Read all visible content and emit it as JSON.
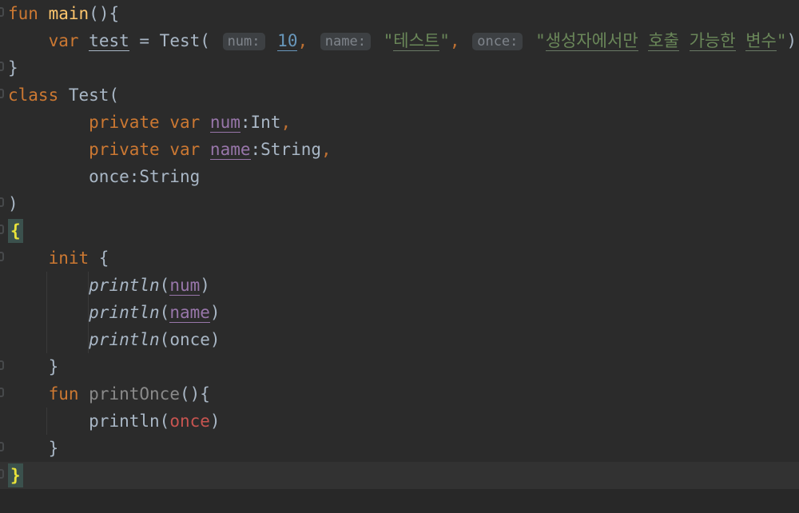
{
  "editor": {
    "language": "Kotlin",
    "theme": "Darcula",
    "colors": {
      "background": "#2B2B2B",
      "current_line": "#323232",
      "default_text": "#A9B7C6",
      "keyword": "#CC7832",
      "function_declaration": "#FFC66D",
      "number": "#6897BB",
      "string": "#6A8759",
      "property": "#9876AA",
      "unused_symbol": "#8A8A8A",
      "error": "#C75450",
      "matched_brace": "#E8E33A",
      "matched_brace_bg": "#3B514D",
      "hint_bg": "#3D4043",
      "hint_fg": "#7F848B",
      "comma": "#BE7032"
    },
    "inlay_hints": [
      "num:",
      "name:",
      "once:"
    ],
    "plain_code": "fun main(){\n    var test = Test(10, \"테스트\", \"생성자에서만 호출 가능한 변수\")\n}\nclass Test(\n        private var num:Int,\n        private var name:String,\n        once:String\n)\n{\n    init {\n        println(num)\n        println(name)\n        println(once)\n    }\n    fun printOnce(){\n        println(once)\n    }\n}",
    "lines": [
      {
        "n": 1,
        "fold": true,
        "tokens": [
          [
            "kw",
            "fun"
          ],
          [
            "sp",
            " "
          ],
          [
            "fn",
            "main"
          ],
          [
            "plain",
            "(){"
          ]
        ]
      },
      {
        "n": 2,
        "tokens": [
          [
            "sp",
            "    "
          ],
          [
            "kw",
            "var"
          ],
          [
            "sp",
            " "
          ],
          [
            "varu",
            "test"
          ],
          [
            "plain",
            " = Test("
          ],
          [
            "sp",
            " "
          ],
          [
            "hint",
            "num:"
          ],
          [
            "sp",
            " "
          ],
          [
            "num",
            "10"
          ],
          [
            "comma",
            ","
          ],
          [
            "sp",
            " "
          ],
          [
            "hint",
            "name:"
          ],
          [
            "sp",
            " "
          ],
          [
            "str",
            "\""
          ],
          [
            "typo",
            "테스트"
          ],
          [
            "str",
            "\""
          ],
          [
            "comma",
            ","
          ],
          [
            "sp",
            " "
          ],
          [
            "hint",
            "once:"
          ],
          [
            "sp",
            " "
          ],
          [
            "str",
            "\""
          ],
          [
            "typo",
            "생성자에서만"
          ],
          [
            "str",
            " "
          ],
          [
            "typo",
            "호출"
          ],
          [
            "str",
            " "
          ],
          [
            "typo",
            "가능한"
          ],
          [
            "str",
            " "
          ],
          [
            "typo",
            "변수"
          ],
          [
            "str",
            "\""
          ],
          [
            "plain",
            ")"
          ]
        ]
      },
      {
        "n": 3,
        "fold": true,
        "tokens": [
          [
            "plain",
            "}"
          ]
        ]
      },
      {
        "n": 4,
        "fold": true,
        "tokens": [
          [
            "kw",
            "class"
          ],
          [
            "plain",
            " Test("
          ]
        ]
      },
      {
        "n": 5,
        "tokens": [
          [
            "sp",
            "        "
          ],
          [
            "kw",
            "private"
          ],
          [
            "sp",
            " "
          ],
          [
            "kw",
            "var"
          ],
          [
            "sp",
            " "
          ],
          [
            "prop",
            "num"
          ],
          [
            "plain",
            ":Int"
          ],
          [
            "comma",
            ","
          ]
        ]
      },
      {
        "n": 6,
        "tokens": [
          [
            "sp",
            "        "
          ],
          [
            "kw",
            "private"
          ],
          [
            "sp",
            " "
          ],
          [
            "kw",
            "var"
          ],
          [
            "sp",
            " "
          ],
          [
            "prop",
            "name"
          ],
          [
            "plain",
            ":String"
          ],
          [
            "comma",
            ","
          ]
        ]
      },
      {
        "n": 7,
        "tokens": [
          [
            "sp",
            "        "
          ],
          [
            "plain",
            "once:String"
          ]
        ]
      },
      {
        "n": 8,
        "fold": true,
        "tokens": [
          [
            "plain",
            ")"
          ]
        ]
      },
      {
        "n": 9,
        "fold": true,
        "tokens": [
          [
            "match",
            "{"
          ]
        ]
      },
      {
        "n": 10,
        "fold": true,
        "tokens": [
          [
            "sp",
            "    "
          ],
          [
            "kw",
            "init"
          ],
          [
            "plain",
            " {"
          ]
        ]
      },
      {
        "n": 11,
        "tokens": [
          [
            "sp",
            "        "
          ],
          [
            "itfn",
            "println"
          ],
          [
            "plain",
            "("
          ],
          [
            "prop",
            "num"
          ],
          [
            "plain",
            ")"
          ]
        ]
      },
      {
        "n": 12,
        "tokens": [
          [
            "sp",
            "        "
          ],
          [
            "itfn",
            "println"
          ],
          [
            "plain",
            "("
          ],
          [
            "prop",
            "name"
          ],
          [
            "plain",
            ")"
          ]
        ]
      },
      {
        "n": 13,
        "tokens": [
          [
            "sp",
            "        "
          ],
          [
            "itfn",
            "println"
          ],
          [
            "plain",
            "(once)"
          ]
        ]
      },
      {
        "n": 14,
        "fold": true,
        "tokens": [
          [
            "sp",
            "    "
          ],
          [
            "plain",
            "}"
          ]
        ]
      },
      {
        "n": 15,
        "fold": true,
        "tokens": [
          [
            "sp",
            "    "
          ],
          [
            "kw",
            "fun"
          ],
          [
            "sp",
            " "
          ],
          [
            "gray",
            "printOnce"
          ],
          [
            "plain",
            "(){"
          ]
        ]
      },
      {
        "n": 16,
        "tokens": [
          [
            "sp",
            "        "
          ],
          [
            "plain",
            "println("
          ],
          [
            "err",
            "once"
          ],
          [
            "plain",
            ")"
          ]
        ]
      },
      {
        "n": 17,
        "fold": true,
        "tokens": [
          [
            "sp",
            "    "
          ],
          [
            "plain",
            "}"
          ]
        ]
      },
      {
        "n": 18,
        "fold": true,
        "highlight": true,
        "tokens": [
          [
            "match",
            "}"
          ]
        ]
      }
    ]
  }
}
